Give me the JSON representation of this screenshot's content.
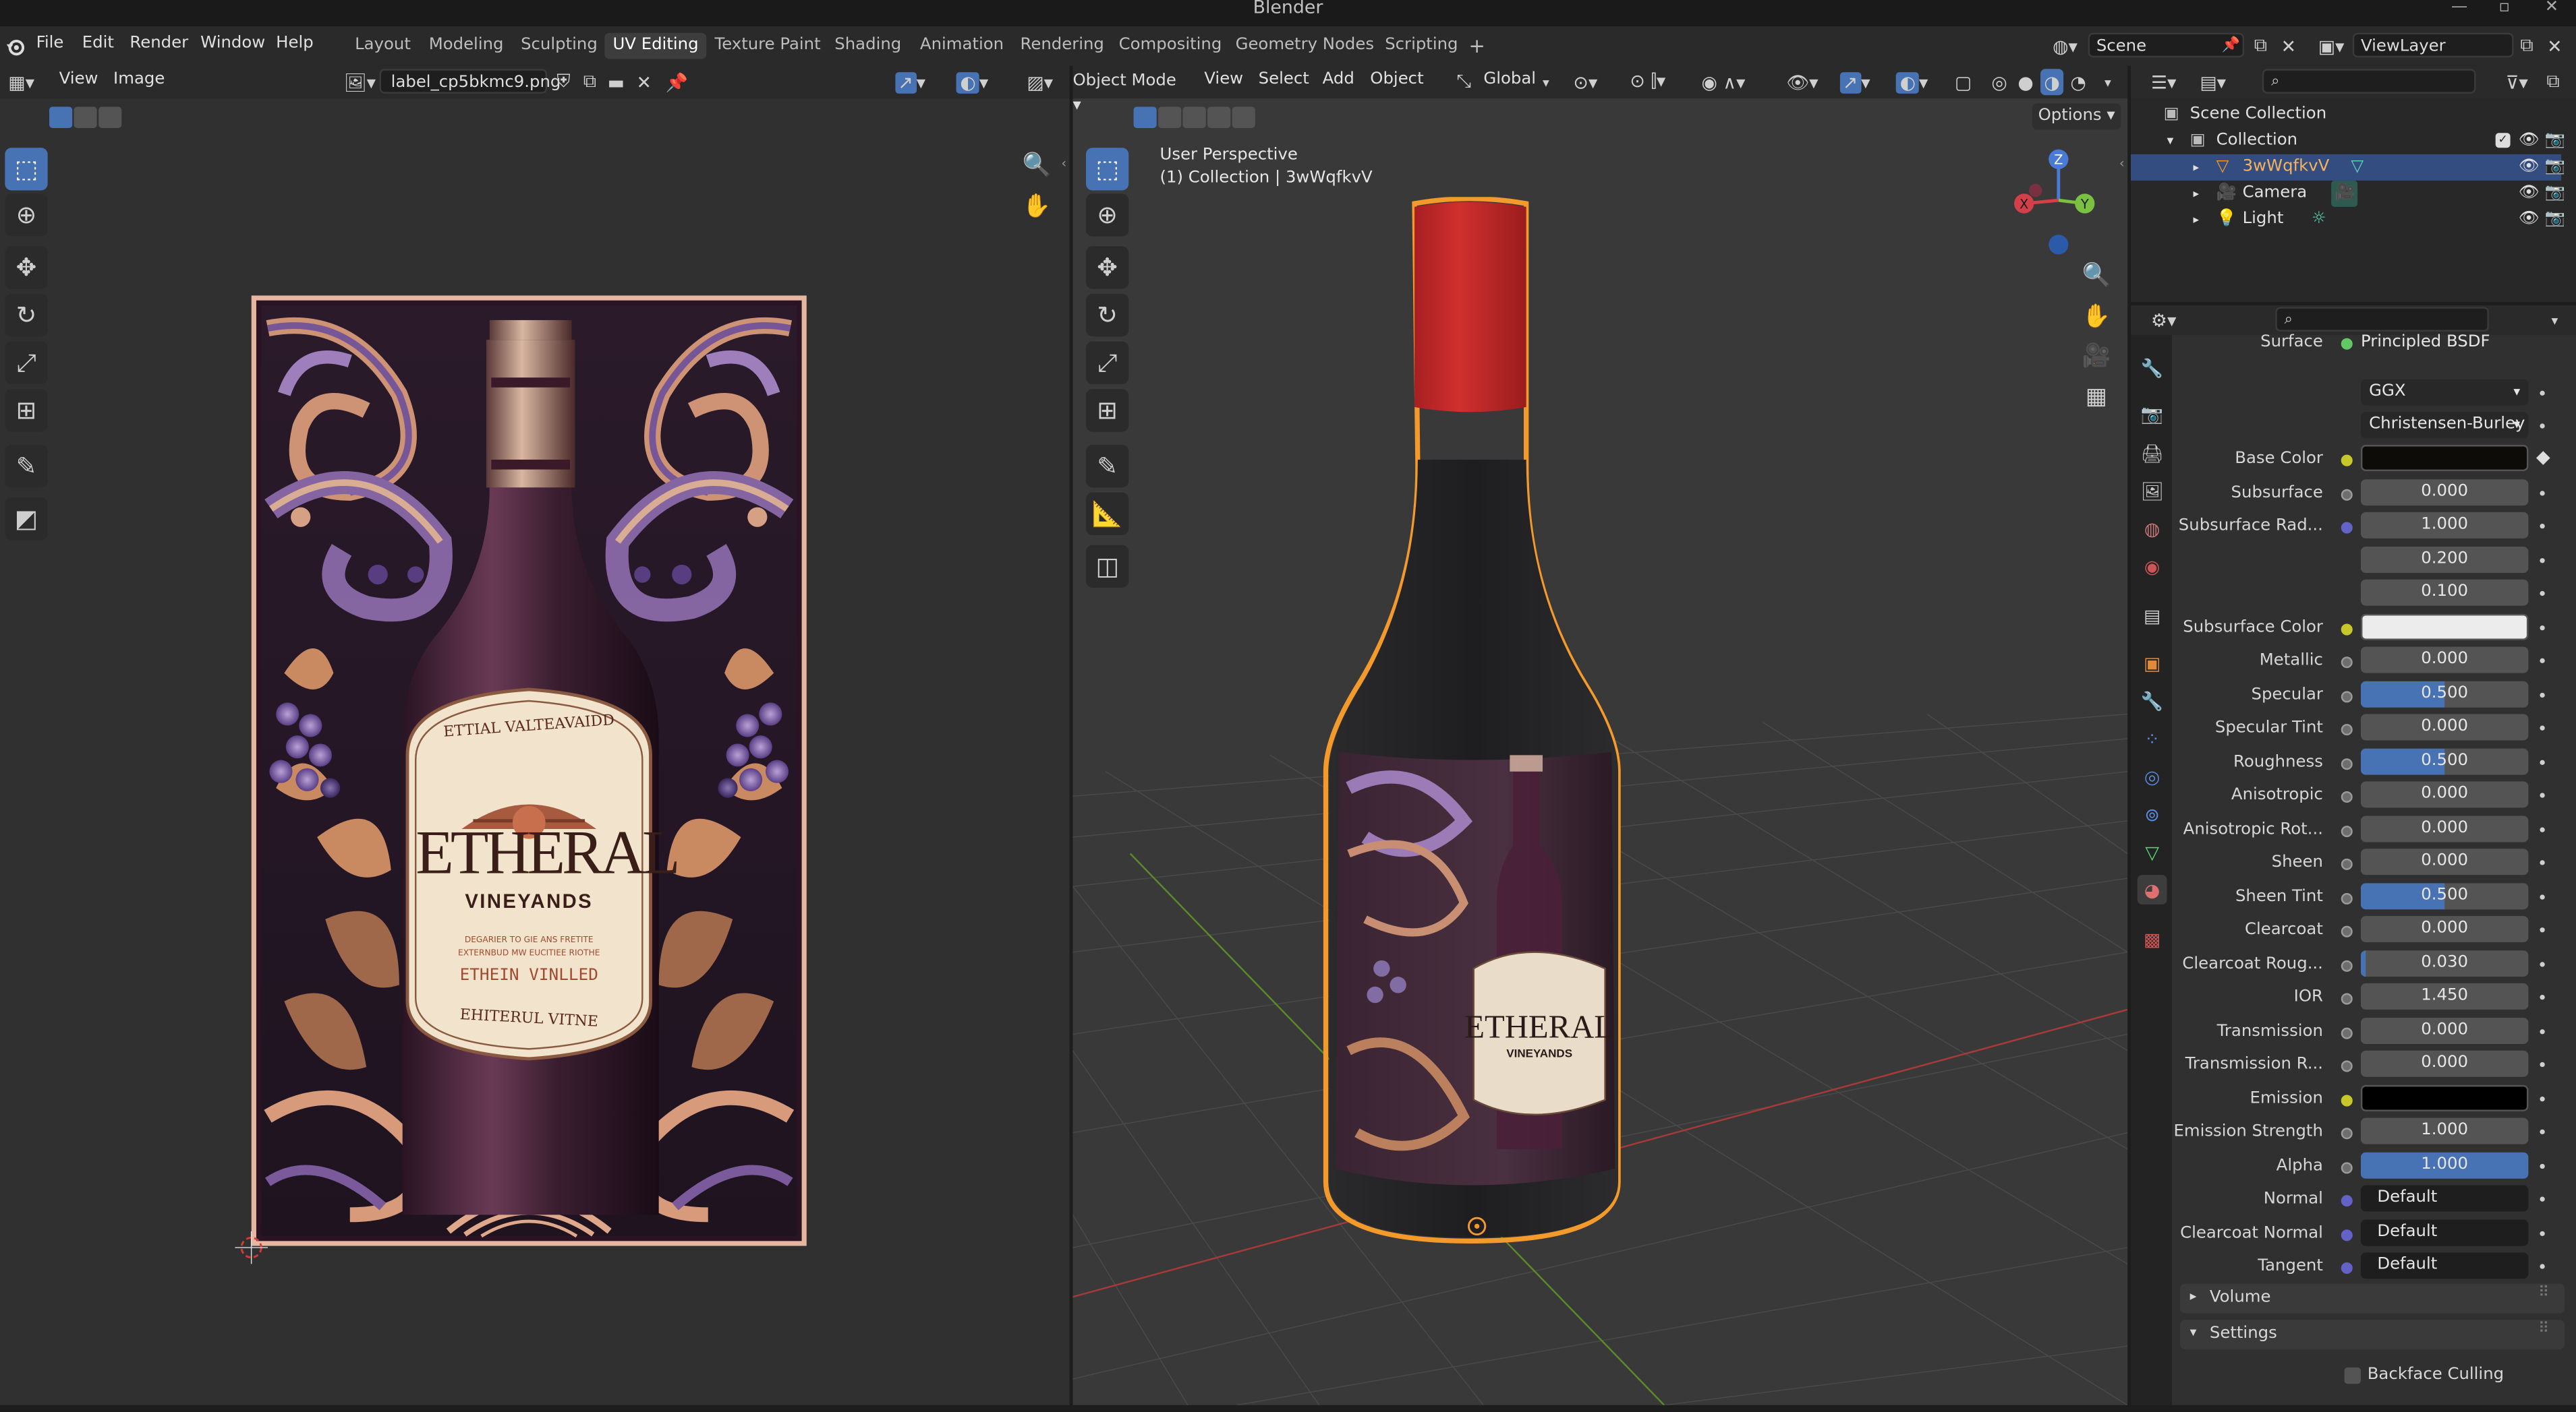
{
  "window": {
    "title": "Blender"
  },
  "menus": [
    "File",
    "Edit",
    "Render",
    "Window",
    "Help"
  ],
  "workspaces": [
    {
      "label": "Layout"
    },
    {
      "label": "Modeling"
    },
    {
      "label": "Sculpting"
    },
    {
      "label": "UV Editing",
      "active": true
    },
    {
      "label": "Texture Paint"
    },
    {
      "label": "Shading"
    },
    {
      "label": "Animation"
    },
    {
      "label": "Rendering"
    },
    {
      "label": "Compositing"
    },
    {
      "label": "Geometry Nodes"
    },
    {
      "label": "Scripting"
    }
  ],
  "add_workspace": "+",
  "scene": {
    "name": "Scene"
  },
  "view_layer": {
    "name": "ViewLayer"
  },
  "uv_editor": {
    "menus": [
      "View",
      "Image"
    ],
    "image_name": "label_cp5bkmc9.png",
    "label_art": {
      "arc_text": "ETTIAL VALTEAVAIDD",
      "brand": "ETHERAL",
      "sub": "VINEYANDS",
      "small1": "DEGARIER TO GIE ANS FRETITE",
      "small2": "EXTERNBUD MW EUCITIEE RIOTHE",
      "small3": "ETHEIN VINLLED",
      "bottom_arc": "EHITERUL VITNE"
    }
  },
  "viewport": {
    "mode": "Object Mode",
    "menus": [
      "View",
      "Select",
      "Add",
      "Object"
    ],
    "transform": "Global",
    "options": "Options",
    "overlay_line1": "User Perspective",
    "overlay_line2": "(1) Collection | 3wWqfkvV",
    "gizmo": {
      "z": "Z",
      "y": "Y",
      "x": "X"
    }
  },
  "outliner": {
    "root": "Scene Collection",
    "collection": "Collection",
    "items": [
      {
        "name": "3wWqfkvV",
        "selected": true
      },
      {
        "name": "Camera",
        "selected": false
      },
      {
        "name": "Light",
        "selected": false
      }
    ]
  },
  "properties": {
    "surface_label": "Surface",
    "surface_value": "Principled BSDF",
    "distribution": "GGX",
    "subsurface_method": "Christensen-Burley",
    "rows": [
      {
        "label": "Base Color",
        "type": "color",
        "color": "#0d0c08",
        "dot": "yel"
      },
      {
        "label": "Subsurface",
        "value": "0.000",
        "fill": 0
      },
      {
        "label": "Subsurface Rad...",
        "value": "1.000",
        "fill": 0,
        "dot": "blu"
      },
      {
        "label": "",
        "value": "0.200",
        "fill": 0,
        "nodot": true
      },
      {
        "label": "",
        "value": "0.100",
        "fill": 0,
        "nodot": true
      },
      {
        "label": "Subsurface Color",
        "type": "color",
        "color": "#ececec",
        "dot": "yel"
      },
      {
        "label": "Metallic",
        "value": "0.000",
        "fill": 0
      },
      {
        "label": "Specular",
        "value": "0.500",
        "fill": 0.5
      },
      {
        "label": "Specular Tint",
        "value": "0.000",
        "fill": 0
      },
      {
        "label": "Roughness",
        "value": "0.500",
        "fill": 0.5
      },
      {
        "label": "Anisotropic",
        "value": "0.000",
        "fill": 0
      },
      {
        "label": "Anisotropic Rot...",
        "value": "0.000",
        "fill": 0
      },
      {
        "label": "Sheen",
        "value": "0.000",
        "fill": 0
      },
      {
        "label": "Sheen Tint",
        "value": "0.500",
        "fill": 0.5
      },
      {
        "label": "Clearcoat",
        "value": "0.000",
        "fill": 0
      },
      {
        "label": "Clearcoat Roug...",
        "value": "0.030",
        "fill": 0.03
      },
      {
        "label": "IOR",
        "value": "1.450",
        "fill": 0
      },
      {
        "label": "Transmission",
        "value": "0.000",
        "fill": 0
      },
      {
        "label": "Transmission R...",
        "value": "0.000",
        "fill": 0
      },
      {
        "label": "Emission",
        "type": "color",
        "color": "#000000",
        "dot": "yel"
      },
      {
        "label": "Emission Strength",
        "value": "1.000",
        "fill": 0
      },
      {
        "label": "Alpha",
        "value": "1.000",
        "fill": 1
      },
      {
        "label": "Normal",
        "type": "link",
        "value": "Default",
        "dot": "blu"
      },
      {
        "label": "Clearcoat Normal",
        "type": "link",
        "value": "Default",
        "dot": "blu"
      },
      {
        "label": "Tangent",
        "type": "link",
        "value": "Default",
        "dot": "blu"
      }
    ],
    "volume_label": "Volume",
    "settings_label": "Settings",
    "backface_label": "Backface Culling"
  },
  "colors": {
    "accent": "#4772b3",
    "selection": "#334d80",
    "object_outline": "#f39a2b",
    "bottle_cap": "#c02a2c"
  }
}
